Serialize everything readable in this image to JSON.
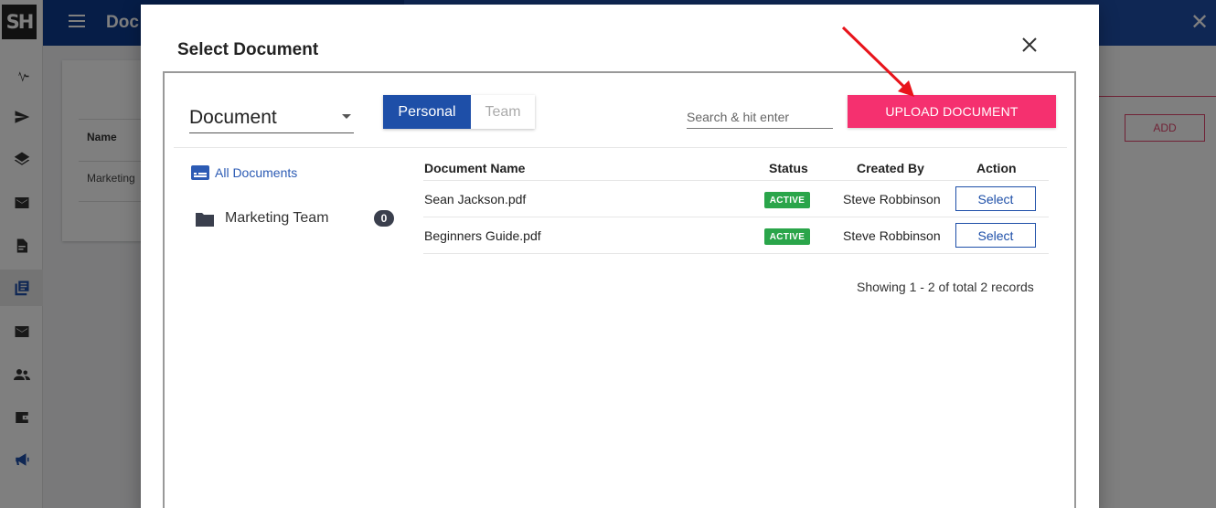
{
  "app": {
    "logo_text": "SH",
    "page_title": "Doc",
    "background_table_header": "Name",
    "background_row": "Marketing",
    "add_label": "ADD"
  },
  "modal": {
    "title": "Select Document",
    "type_select_value": "Document",
    "toggle": {
      "personal_label": "Personal",
      "team_label": "Team",
      "active": "Personal"
    },
    "search_placeholder": "Search & hit enter",
    "upload_label": "UPLOAD DOCUMENT",
    "folders": {
      "all_label": "All Documents",
      "items": [
        {
          "label": "Marketing Team",
          "count": "0"
        }
      ]
    },
    "table": {
      "headers": {
        "name": "Document Name",
        "status": "Status",
        "created_by": "Created By",
        "action": "Action"
      },
      "rows": [
        {
          "name": "Sean Jackson.pdf",
          "status": "ACTIVE",
          "created_by": "Steve Robbinson",
          "action": "Select"
        },
        {
          "name": "Beginners Guide.pdf",
          "status": "ACTIVE",
          "created_by": "Steve Robbinson",
          "action": "Select"
        }
      ]
    },
    "records_text": "Showing 1 - 2 of total 2 records"
  },
  "colors": {
    "primary": "#1e4fa8",
    "upload": "#f5306f",
    "status_active": "#2aa54a",
    "annotation_arrow": "#e8141b"
  },
  "icons": {
    "sidebar": [
      "activity-icon",
      "send-icon",
      "layers-icon",
      "mail-icon",
      "document-icon",
      "library-icon",
      "inbox-icon",
      "people-icon",
      "wallet-icon",
      "megaphone-icon"
    ]
  }
}
